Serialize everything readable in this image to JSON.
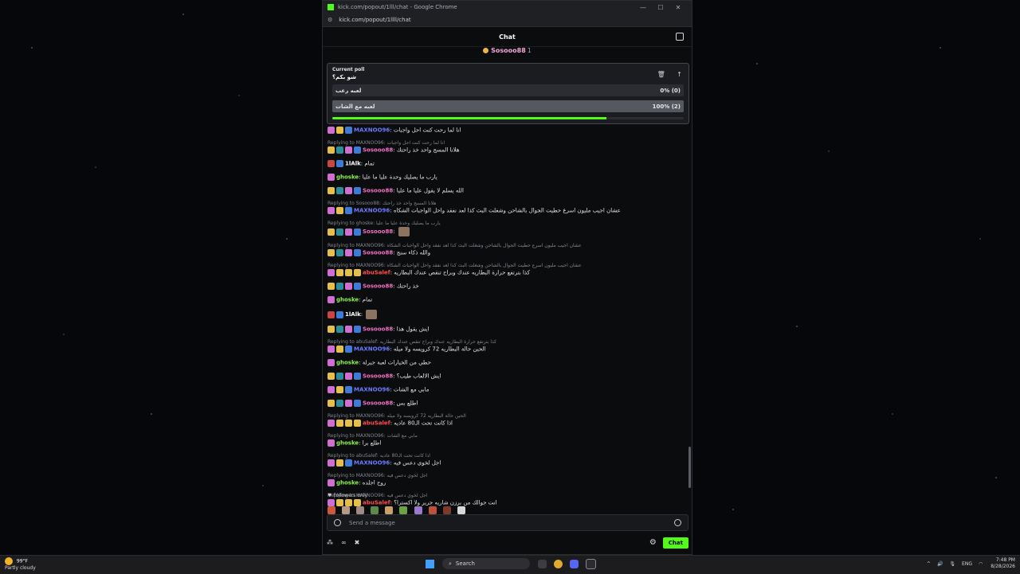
{
  "browser": {
    "title": "kick.com/popout/1lll/chat - Google Chrome",
    "url": "kick.com/popout/1llll/chat"
  },
  "chat": {
    "header": "Chat",
    "pinned_user": "Sosooo88",
    "pinned_count": "1"
  },
  "poll": {
    "label": "Current poll",
    "question": "شو بكم؟",
    "options": [
      {
        "label": "لعبه رعب",
        "result": "0% (0)",
        "fraction": 0
      },
      {
        "label": "لعبه مع الشات",
        "result": "100% (2)",
        "fraction": 1
      }
    ],
    "time_remaining_fraction": 0.78
  },
  "messages": [
    {
      "reply": "",
      "user": "MAXNOO96",
      "color": "blue",
      "text": "انا لما رحت كنت احل واجبات"
    },
    {
      "reply": "Replying to MAXNOO96: انا لما رحت كنت احل واجبات",
      "user": "Sosooo88",
      "color": "pink",
      "text": "هلانا المسج واحد خذ راحتك"
    },
    {
      "reply": "",
      "user": "1lAlk",
      "color": "white",
      "text": "تمام"
    },
    {
      "reply": "",
      "user": "ghoske",
      "color": "green",
      "text": "يارب ما يصليك وحدة عليا ما عليا"
    },
    {
      "reply": "",
      "user": "Sosooo88",
      "color": "pink",
      "text": "الله يسلم لا يقول عليا ما عليا"
    },
    {
      "reply": "Replying to Sosooo88: هلانا المسج واحد خذ راحتك",
      "user": "MAXNOO96",
      "color": "blue",
      "text": "عشان اجيب مليون اسرع حطيت الجوال بالشاحن وشغلت البث كذا لعد نفقد واحل الواجبات الشكاه"
    },
    {
      "reply": "Replying to ghoske: يارب ما يصليك وحدة عليا ما عليا",
      "user": "Sosooo88",
      "color": "pink",
      "text": ""
    },
    {
      "reply": "Replying to MAXNOO96: عشان اجيب مليون اسرع حطيت الجوال بالشاحن وشغلت البث كذا لعد نفقد واحل الواجبات الشكاه",
      "user": "Sosooo88",
      "color": "pink",
      "text": "والله ذكاء سنج"
    },
    {
      "reply": "Replying to MAXNOO96: عشان اجيب مليون اسرع حطيت الجوال بالشاحن وشغلت البث كذا لعد نفقد واحل الواجبات الشكاه",
      "user": "abuSalef",
      "color": "red",
      "text": "كذا بترتفع حرارة البطاريه عندك وبراح تنقص عندك البطاريه"
    },
    {
      "reply": "",
      "user": "Sosooo88",
      "color": "pink",
      "text": "خذ راحتك"
    },
    {
      "reply": "",
      "user": "ghoske",
      "color": "green",
      "text": "تمام"
    },
    {
      "reply": "",
      "user": "1lAlk",
      "color": "white",
      "text": ""
    },
    {
      "reply": "",
      "user": "Sosooo88",
      "color": "pink",
      "text": "ايش يقول هذا"
    },
    {
      "reply": "Replying to abuSalef: كذا بترتفع حرارة البطاريه عندك وبراح تنقص عندك البطاريه",
      "user": "MAXNOO96",
      "color": "blue",
      "text": "الحين حالة البطاريه 72 كرويسه ولا ميله"
    },
    {
      "reply": "",
      "user": "ghoske",
      "color": "green",
      "text": "حطي من الخيارات لعبة جيرلة"
    },
    {
      "reply": "",
      "user": "Sosooo88",
      "color": "pink",
      "text": "ايش الالعاب طيب؟"
    },
    {
      "reply": "",
      "user": "MAXNOO96",
      "color": "blue",
      "text": "مابي مع الشات"
    },
    {
      "reply": "",
      "user": "Sosooo88",
      "color": "pink",
      "text": "اطلع بس"
    },
    {
      "reply": "Replying to MAXNOO96: الحين حالة البطاريه 72 كرويسه ولا ميله",
      "user": "abuSalef",
      "color": "red",
      "text": "اذا كانت تحت الـ80 عاديه"
    },
    {
      "reply": "Replying to MAXNOO96: مابي مع الشات",
      "user": "ghoske",
      "color": "green",
      "text": "اطلع برا"
    },
    {
      "reply": "Replying to abuSalef: اذا كانت تحت الـ80 عاديه",
      "user": "MAXNOO96",
      "color": "blue",
      "text": "اجل لخوي دعس فيه"
    },
    {
      "reply": "Replying to MAXNOO96: اجل لخوي دعس فيه",
      "user": "ghoske",
      "color": "green",
      "text": "روح اجلده"
    },
    {
      "reply": "Replying to MAXNOO96: اجل لخوي دعس فيه",
      "user": "abuSalef",
      "color": "red",
      "text": "انت جوالك من برزن شاريه جرير ولا اكسترا؟"
    }
  ],
  "footer": {
    "followers_only": "Followers only",
    "input_placeholder": "Send a message",
    "infinity": "∞",
    "chat_button": "Chat"
  },
  "taskbar": {
    "temp": "99°F",
    "weather": "Partly cloudy",
    "search": "Search",
    "lang": "ENG",
    "time": "7:48 PM",
    "date": "8/28/2026"
  },
  "colors": {
    "accent": "#53fc18",
    "pink": "#f06fc5",
    "blue": "#6b7bff",
    "green": "#8bf04f",
    "red": "#ff4d4d"
  }
}
